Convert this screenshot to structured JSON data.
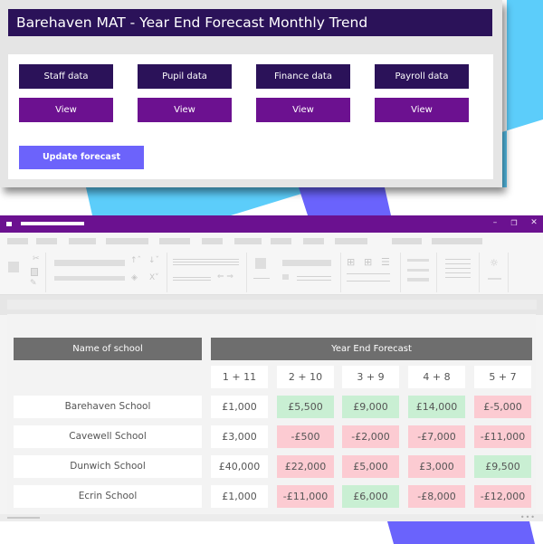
{
  "colors": {
    "title_bar": "#2b1259",
    "view_button": "#6c1190",
    "update_button": "#6c63fb",
    "app_titlebar": "#6b1190",
    "header_cell": "#6e6e6e",
    "positive_cell": "#c9efd3",
    "negative_cell": "#fccbd2",
    "accent_light_blue": "#5ccdfa",
    "accent_indigo": "#6a63fc"
  },
  "panel": {
    "title": "Barehaven MAT - Year End Forecast Monthly Trend",
    "data_buttons": [
      {
        "label": "Staff data",
        "view_label": "View"
      },
      {
        "label": "Pupil data",
        "view_label": "View"
      },
      {
        "label": "Finance data",
        "view_label": "View"
      },
      {
        "label": "Payroll data",
        "view_label": "View"
      }
    ],
    "update_button": "Update forecast"
  },
  "window": {
    "controls": {
      "minimize": "–",
      "restore": "❐",
      "close": "✕"
    }
  },
  "table": {
    "name_header": "Name of school",
    "forecast_header": "Year End Forecast",
    "periods": [
      "1 + 11",
      "2 + 10",
      "3 + 9",
      "4 + 8",
      "5 + 7"
    ],
    "rows": [
      {
        "school": "Barehaven School",
        "values": [
          {
            "text": "£1,000",
            "status": "neutral"
          },
          {
            "text": "£5,500",
            "status": "positive"
          },
          {
            "text": "£9,000",
            "status": "positive"
          },
          {
            "text": "£14,000",
            "status": "positive"
          },
          {
            "text": "£-5,000",
            "status": "negative"
          }
        ]
      },
      {
        "school": "Cavewell School",
        "values": [
          {
            "text": "£3,000",
            "status": "neutral"
          },
          {
            "text": "-£500",
            "status": "negative"
          },
          {
            "text": "-£2,000",
            "status": "negative"
          },
          {
            "text": "-£7,000",
            "status": "negative"
          },
          {
            "text": "-£11,000",
            "status": "negative"
          }
        ]
      },
      {
        "school": "Dunwich School",
        "values": [
          {
            "text": "£40,000",
            "status": "neutral"
          },
          {
            "text": "£22,000",
            "status": "negative"
          },
          {
            "text": "£5,000",
            "status": "negative"
          },
          {
            "text": "£3,000",
            "status": "negative"
          },
          {
            "text": "£9,500",
            "status": "positive"
          }
        ]
      },
      {
        "school": "Ecrin School",
        "values": [
          {
            "text": "£1,000",
            "status": "neutral"
          },
          {
            "text": "-£11,000",
            "status": "negative"
          },
          {
            "text": "£6,000",
            "status": "positive"
          },
          {
            "text": "-£8,000",
            "status": "negative"
          },
          {
            "text": "-£12,000",
            "status": "negative"
          }
        ]
      }
    ]
  },
  "statusbar": {
    "more_label": "•••"
  }
}
